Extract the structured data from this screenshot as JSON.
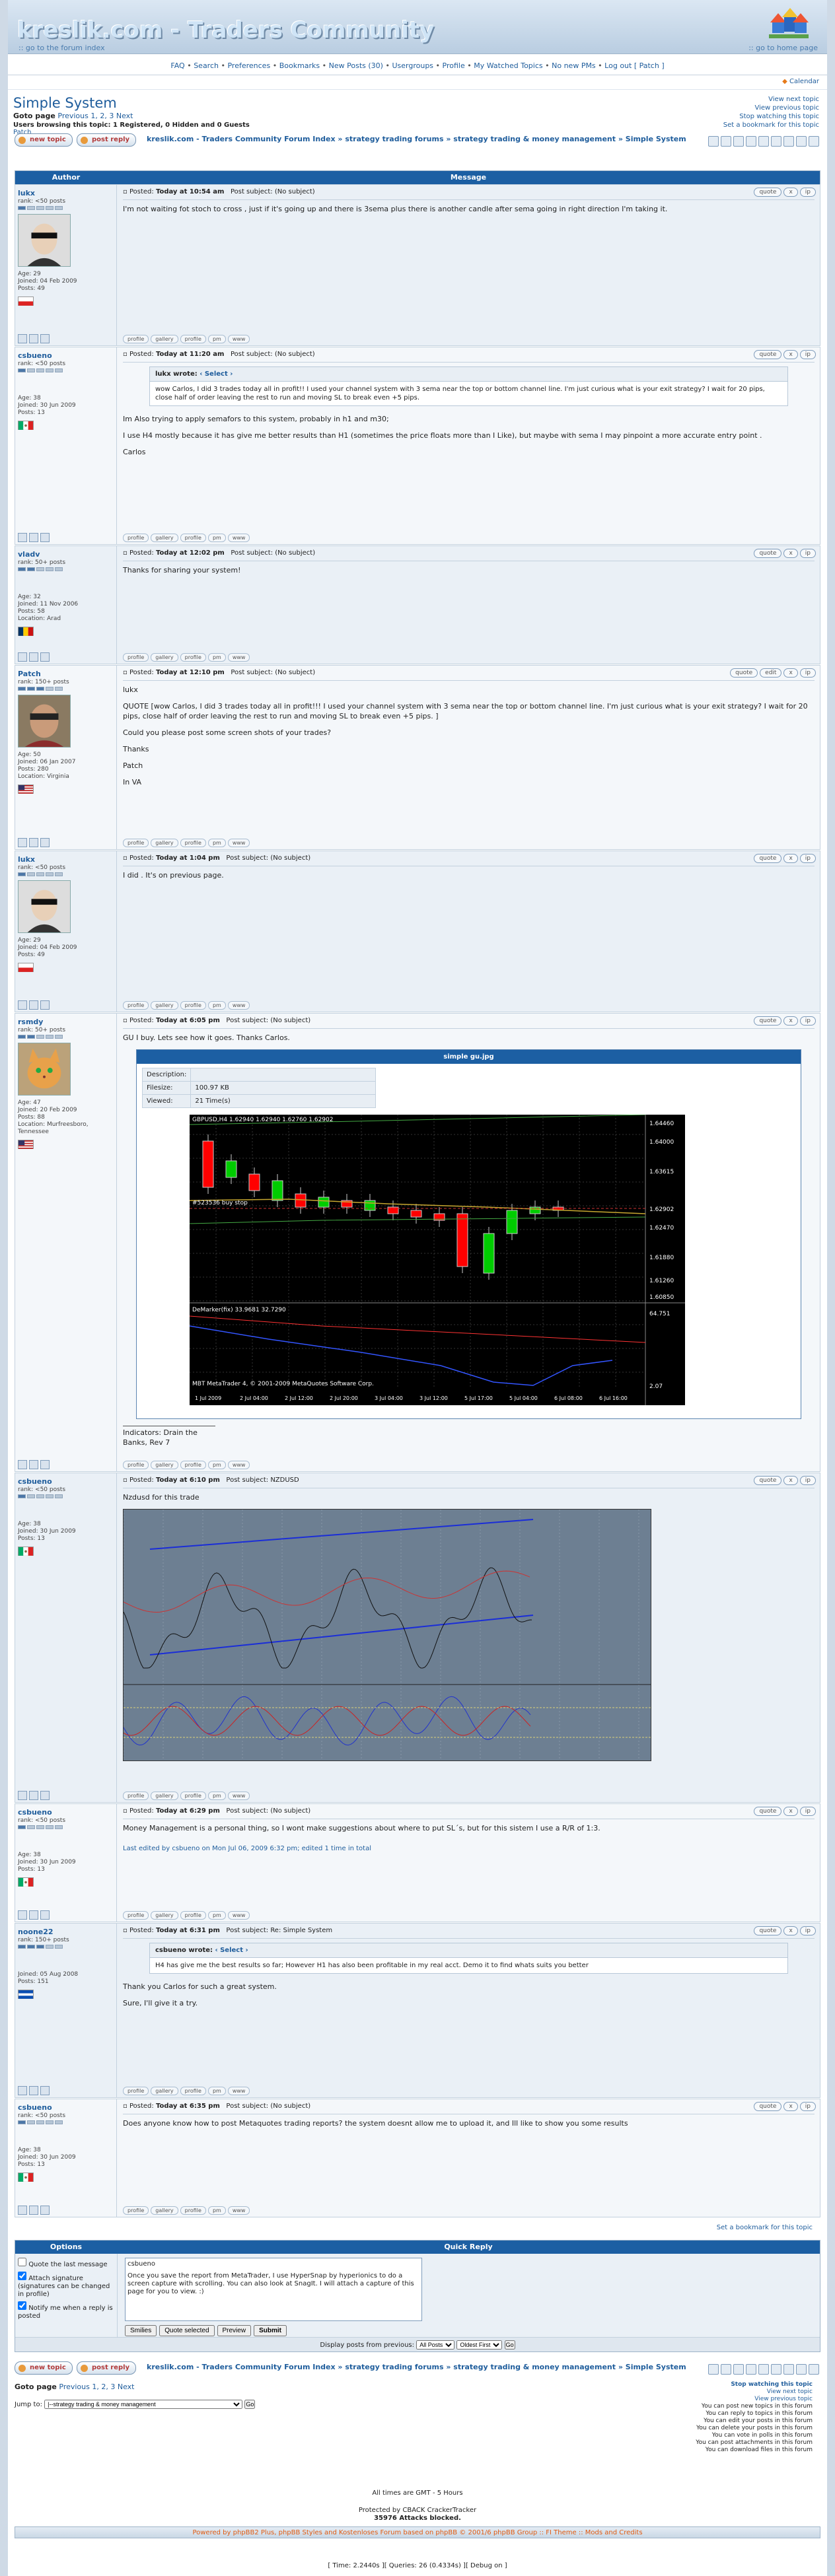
{
  "site": {
    "logo": "kreslik.com - Traders Community",
    "forum_index_link": ":: go to the forum index",
    "home_link": ":: go to home page"
  },
  "nav": [
    "FAQ",
    "Search",
    "Preferences",
    "Bookmarks",
    "New Posts (30)",
    "Usergroups",
    "Profile",
    "My Watched Topics",
    "No new PMs",
    "Log out [ Patch ]"
  ],
  "calendar": "Calendar",
  "topic": {
    "title": "Simple System",
    "goto_label": "Goto page",
    "goto_prev": "Previous",
    "goto_pages": "1, 2, 3",
    "goto_next": "Next",
    "users_browsing": "Users browsing this topic: 1 Registered, 0 Hidden and 0 Guests",
    "watcher": "Patch",
    "right_links": [
      "View next topic",
      "View previous topic",
      "Stop watching this topic",
      "Set a bookmark for this topic"
    ],
    "breadcrumb": "kreslik.com - Traders Community Forum Index » strategy trading forums » strategy trading & money management » Simple System",
    "new_topic": "new topic",
    "post_reply": "post reply"
  },
  "table_header": {
    "author": "Author",
    "message": "Message"
  },
  "post_buttons": [
    "quote",
    "edit",
    "x",
    "ip"
  ],
  "footer_buttons": [
    "profile",
    "gallery",
    "profile",
    "pm",
    "www"
  ],
  "posts": [
    {
      "author": "lukx",
      "rank": "rank: <50 posts",
      "age": "Age: 29",
      "joined": "Joined: 04 Feb 2009",
      "posts": "Posts: 49",
      "location": "",
      "time": "Today at 10:54 am",
      "subject": "(No subject)",
      "text": [
        "I'm not waiting fot stoch to cross , just if it's going up and there is 3sema plus there is another candle after sema going in right direction I'm taking it."
      ]
    },
    {
      "author": "csbueno",
      "rank": "rank: <50 posts",
      "age": "Age: 38",
      "joined": "Joined: 30 Jun 2009",
      "posts": "Posts: 13",
      "location": "",
      "time": "Today at 11:20 am",
      "subject": "(No subject)",
      "quote_author": "lukx wrote:",
      "quote_select": "Select",
      "quote_text": "wow Carlos, I did 3 trades today all in profit!! I used your channel system with 3 sema near the top or bottom channel line. I'm just curious what is your exit strategy? I wait for 20 pips, close half of order leaving the rest to run and moving SL to break even +5 pips.",
      "text": [
        "Im Also trying to apply semafors to this system, probably in h1 and m30;",
        "I use H4 mostly because it has give me better results than H1 (sometimes the price floats more than I Like), but maybe with sema I may pinpoint a more accurate entry point .",
        "Carlos"
      ]
    },
    {
      "author": "vladv",
      "rank": "rank: 50+ posts",
      "age": "Age: 32",
      "joined": "Joined: 11 Nov 2006",
      "posts": "Posts: 58",
      "location": "Location: Arad",
      "time": "Today at 12:02 pm",
      "subject": "(No subject)",
      "text": [
        "Thanks for sharing your system!"
      ]
    },
    {
      "author": "Patch",
      "rank": "rank: 150+ posts",
      "age": "Age: 50",
      "joined": "Joined: 06 Jan 2007",
      "posts": "Posts: 280",
      "location": "Location: Virginia",
      "time": "Today at 12:10 pm",
      "subject": "(No subject)",
      "text": [
        "lukx",
        "QUOTE [wow Carlos, I did 3 trades today all in profit!!! I used your channel system with 3 sema near the top or bottom channel line. I'm just curious what is your exit strategy? I wait for 20 pips, close half of order leaving the rest to run and moving SL to break even +5 pips. ]",
        "Could you please post some screen shots of your trades?",
        "Thanks",
        "Patch",
        "In VA"
      ]
    },
    {
      "author": "lukx",
      "rank": "rank: <50 posts",
      "age": "Age: 29",
      "joined": "Joined: 04 Feb 2009",
      "posts": "Posts: 49",
      "location": "",
      "time": "Today at 1:04 pm",
      "subject": "(No subject)",
      "text": [
        "I did . It's on previous page."
      ]
    },
    {
      "author": "rsmdy",
      "rank": "rank: 50+ posts",
      "age": "Age: 47",
      "joined": "Joined: 20 Feb 2009",
      "posts": "Posts: 88",
      "location": "Location: Murfreesboro, Tennessee",
      "time": "Today at 6:05 pm",
      "subject": "(No subject)",
      "text": [
        "GU I buy. Lets see how it goes. Thanks Carlos."
      ],
      "attachment": {
        "title": "simple gu.jpg",
        "rows": [
          [
            "Description:",
            ""
          ],
          [
            "Filesize:",
            "100.97 KB"
          ],
          [
            "Viewed:",
            "21 Time(s)"
          ]
        ],
        "chart_label": "GBPUSD,H4 1.62940 1.62940 1.62760 1.62902",
        "chart_sub": "#523536 buy stop",
        "osc_label": "DeMarker(fix) 33.9681 32.7290",
        "copyright": "MBT MetaTrader 4, © 2001-2009 MetaQuotes Software Corp.",
        "yticks": [
          "1.64460",
          "1.64000",
          "1.63615",
          "1.62902",
          "1.62470",
          "1.61880",
          "1.61260",
          "1.60850",
          "64.751",
          "2.07"
        ],
        "xticks": [
          "1 Jul 2009",
          "2 Jul 04:00",
          "2 Jul 12:00",
          "2 Jul 20:00",
          "3 Jul 04:00",
          "3 Jul 12:00",
          "5 Jul 17:00",
          "5 Jul 04:00",
          "6 Jul 08:00",
          "6 Jul 16:00"
        ]
      },
      "signature": "Indicators: Drain the Banks, Rev 7"
    },
    {
      "author": "csbueno",
      "rank": "rank: <50 posts",
      "age": "Age: 38",
      "joined": "Joined: 30 Jun 2009",
      "posts": "Posts: 13",
      "location": "",
      "time": "Today at 6:10 pm",
      "subject": "NZDUSD",
      "text": [
        "Nzdusd for this trade"
      ]
    },
    {
      "author": "csbueno",
      "rank": "rank: <50 posts",
      "age": "Age: 38",
      "joined": "Joined: 30 Jun 2009",
      "posts": "Posts: 13",
      "location": "",
      "time": "Today at 6:29 pm",
      "subject": "(No subject)",
      "text": [
        "Money Management is a personal thing, so I wont make suggestions about where to put SL´s, but for this sistem I use a R/R of 1:3."
      ],
      "edited": "Last edited by csbueno on Mon Jul 06, 2009 6:32 pm; edited 1 time in total"
    },
    {
      "author": "noone22",
      "rank": "rank: 150+ posts",
      "age": "",
      "joined": "Joined: 05 Aug 2008",
      "posts": "Posts: 151",
      "location": "",
      "time": "Today at 6:31 pm",
      "subject": "Re: Simple System",
      "quote_author": "csbueno wrote:",
      "quote_select": "Select",
      "quote_text": "H4 has give me the best results so far; However H1 has also been profitable in my real acct. Demo it to find whats suits you better",
      "text": [
        "Thank you Carlos for such a great system.",
        "Sure, I'll give it a try."
      ]
    },
    {
      "author": "csbueno",
      "rank": "rank: <50 posts",
      "age": "Age: 38",
      "joined": "Joined: 30 Jun 2009",
      "posts": "Posts: 13",
      "location": "",
      "time": "Today at 6:35 pm",
      "subject": "(No subject)",
      "text": [
        "Does anyone know how to post Metaquotes trading reports? the system doesnt allow me to upload it, and Ill like to show you some results"
      ]
    }
  ],
  "posted_label": "Posted:",
  "subject_label": "Post subject:",
  "set_bookmark": "Set a bookmark for this topic",
  "quick_reply": {
    "options_title": "Options",
    "reply_title": "Quick Reply",
    "opt1": "Quote the last message",
    "opt2": "Attach signature (signatures can be changed in profile)",
    "opt3": "Notify me when a reply is posted",
    "username": "csbueno",
    "message": "Once you save the report from MetaTrader, I use HyperSnap by hyperionics to do a screen capture with scrolling. You can also look at SnagIt. I will attach a capture of this page for you to view. :)",
    "buttons": [
      "Smilies",
      "Quote selected",
      "Preview",
      "Submit"
    ],
    "display_label": "Display posts from previous:",
    "display_select": "All Posts",
    "order_select": "Oldest First",
    "go": "Go"
  },
  "bottom": {
    "jump_label": "Jump to:",
    "jump_value": "|--strategy trading & money management",
    "jump_go": "Go",
    "perms": [
      "You can post new topics in this forum",
      "You can reply to topics in this forum",
      "You can edit your posts in this forum",
      "You can delete your posts in this forum",
      "You can vote in polls in this forum",
      "You can post attachments in this forum",
      "You can download files in this forum"
    ],
    "watch": "Stop watching this topic",
    "timezone": "All times are GMT - 5 Hours",
    "protected": "Protected by CBACK CrackerTracker",
    "blocked": "35976 Attacks blocked.",
    "powered": "Powered by phpBB2 Plus, phpBB Styles and Kostenloses Forum based on phpBB © 2001/6 phpBB Group :: FI Theme :: Mods and Credits",
    "stats": "[ Time: 2.2440s ][ Queries: 26 (0.4334s) ][ Debug on ]"
  },
  "colors": {
    "header_blue": "#1c5fa3",
    "link": "#1f5d9c",
    "post_alt": "#eaf0f6"
  }
}
